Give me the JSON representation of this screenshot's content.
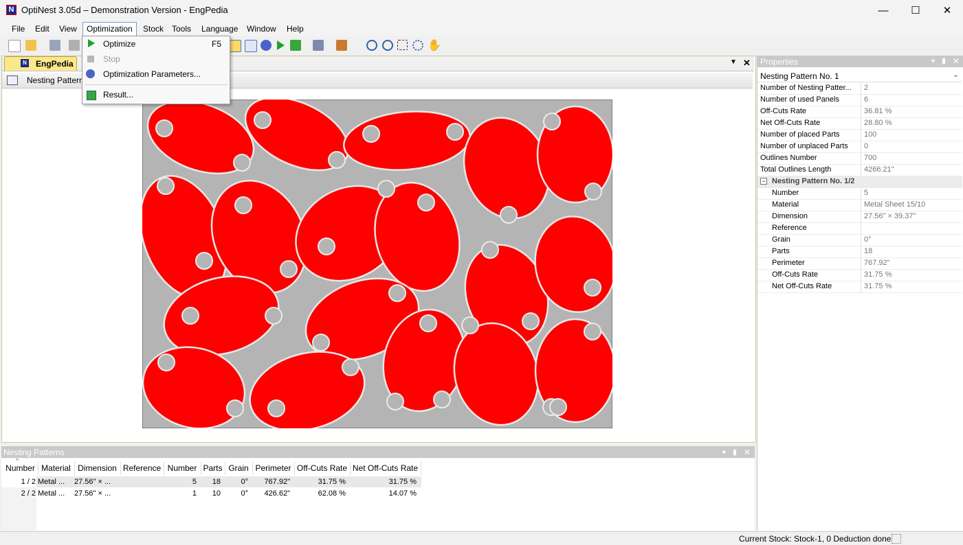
{
  "window": {
    "title": "OptiNest 3.05d – Demonstration Version - EngPedia",
    "app_icon": "N"
  },
  "menubar": [
    "File",
    "Edit",
    "View",
    "Optimization",
    "Stock",
    "Tools",
    "Language",
    "Window",
    "Help"
  ],
  "optimization_menu": {
    "items": [
      {
        "label": "Optimize",
        "shortcut": "F5",
        "icon": "play-icon",
        "enabled": true
      },
      {
        "label": "Stop",
        "shortcut": "",
        "icon": "stop-icon",
        "enabled": false
      },
      {
        "label": "Optimization Parameters...",
        "shortcut": "",
        "icon": "gear-icon",
        "enabled": true
      },
      {
        "label": "Result...",
        "shortcut": "",
        "icon": "result-icon",
        "enabled": true
      }
    ]
  },
  "document": {
    "tab_label": "EngPedia",
    "sub_label": "Nesting Pattern"
  },
  "properties": {
    "title": "Properties",
    "selector": "Nesting Pattern No. 1",
    "rows": [
      {
        "name": "Number of Nesting Patter...",
        "value": "2"
      },
      {
        "name": "Number of used Panels",
        "value": "6"
      },
      {
        "name": "Off-Cuts Rate",
        "value": "36.81 %"
      },
      {
        "name": "Net Off-Cuts Rate",
        "value": "28.80 %"
      },
      {
        "name": "Number of placed Parts",
        "value": "100"
      },
      {
        "name": "Number of unplaced Parts",
        "value": "0"
      },
      {
        "name": "Outlines Number",
        "value": "700"
      },
      {
        "name": "Total Outlines Length",
        "value": "4266.21\""
      }
    ],
    "group": {
      "title": "Nesting Pattern No. 1/2",
      "rows": [
        {
          "name": "Number",
          "value": "5"
        },
        {
          "name": "Material",
          "value": "Metal Sheet 15/10"
        },
        {
          "name": "Dimension",
          "value": "27.56\" × 39.37\""
        },
        {
          "name": "Reference",
          "value": ""
        },
        {
          "name": "Grain",
          "value": "0°"
        },
        {
          "name": "Parts",
          "value": "18"
        },
        {
          "name": "Perimeter",
          "value": "767.92\""
        },
        {
          "name": "Off-Cuts Rate",
          "value": "31.75 %"
        },
        {
          "name": "Net Off-Cuts Rate",
          "value": "31.75 %"
        }
      ]
    }
  },
  "nesting_patterns": {
    "title": "Nesting Patterns",
    "columns": [
      "Number",
      "Material",
      "Dimension",
      "Reference",
      "Number",
      "Parts",
      "Grain",
      "Perimeter",
      "Off-Cuts Rate",
      "Net Off-Cuts Rate"
    ],
    "rows": [
      [
        "1 / 2",
        "Metal ...",
        "27.56\" × ...",
        "",
        "5",
        "18",
        "0°",
        "767.92\"",
        "31.75 %",
        "31.75 %"
      ],
      [
        "2 / 2",
        "Metal ...",
        "27.56\" × ...",
        "",
        "1",
        "10",
        "0°",
        "426.62\"",
        "62.08 %",
        "14.07 %"
      ]
    ]
  },
  "status": {
    "text": "Current Stock: Stock-1, 0 Deduction done"
  },
  "colors": {
    "part_fill": "#ff0000",
    "sheet": "#b4b4b4",
    "tab_active": "#fce88a"
  }
}
